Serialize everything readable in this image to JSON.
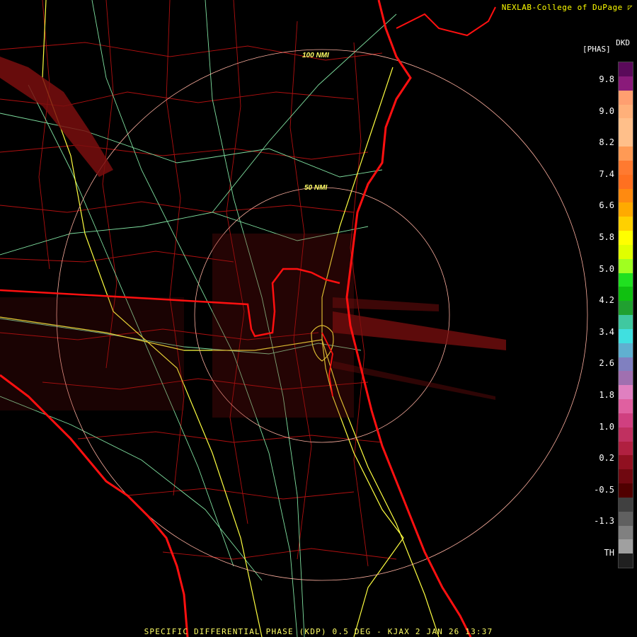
{
  "credit": "NEXLAB-College of DuPage",
  "credit_icon": "nexlab-logo-icon",
  "legend": {
    "units_top": "DKD",
    "units_bottom": "[PHAS]",
    "ticks": [
      "9.8",
      "9.0",
      "8.2",
      "7.4",
      "6.6",
      "5.8",
      "5.0",
      "4.2",
      "3.4",
      "2.6",
      "1.8",
      "1.0",
      "0.2",
      "-0.5",
      "-1.3",
      "TH"
    ],
    "colors": [
      "#5a0a5a",
      "#8a1a7a",
      "#ff9f70",
      "#ffb07a",
      "#ffbf8a",
      "#ffbf8a",
      "#ff9a55",
      "#ff7a30",
      "#ff7020",
      "#ff8a10",
      "#ffaa00",
      "#ffd000",
      "#ffff00",
      "#e0ff00",
      "#a0ff20",
      "#20e020",
      "#10c010",
      "#20a030",
      "#40c8a0",
      "#40e0e0",
      "#60b0d0",
      "#8080c0",
      "#a070b0",
      "#e080c0",
      "#e060a0",
      "#d04080",
      "#c03060",
      "#b02040",
      "#901020",
      "#700810",
      "#500000",
      "#404040",
      "#606060",
      "#808080",
      "#a0a0a0",
      "#202020"
    ]
  },
  "rings": {
    "inner_label": "50 NMI",
    "outer_label": "100 NMI"
  },
  "caption": "SPECIFIC DIFFERENTIAL PHASE (KDP) 0.5 DEG - KJAX 2 JAN 26 13:37"
}
